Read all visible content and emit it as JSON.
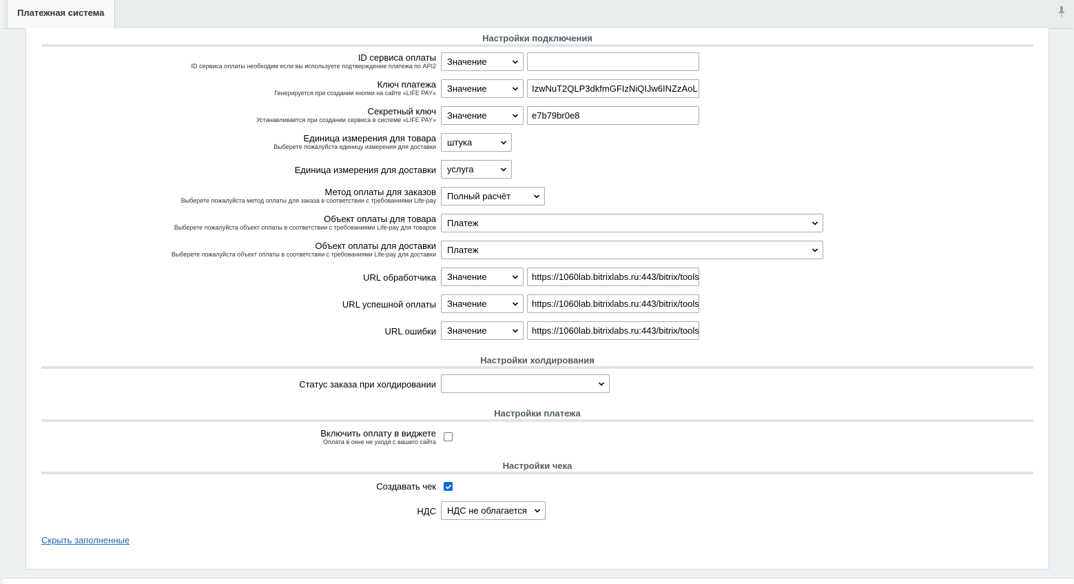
{
  "tab": {
    "title": "Платежная система"
  },
  "sections": {
    "connection": "Настройки подключения",
    "holding": "Настройки холдирования",
    "payment": "Настройки платежа",
    "receipt": "Настройки чека"
  },
  "fields": {
    "service_id": {
      "label": "ID сервиса оплаты",
      "hint": "ID сервиса оплаты необходим если вы используете подтверждение платежа по API2",
      "type": "Значение",
      "value": ""
    },
    "payment_key": {
      "label": "Ключ платежа",
      "hint": "Генерируется при создании кнопки на сайте «LIFE PAY»",
      "type": "Значение",
      "value": "IzwNuT2QLP3dkfmGFIzNiQIJw6INZzAoL"
    },
    "secret_key": {
      "label": "Секретный ключ",
      "hint": "Устанавливается при создании сервиса в системе «LIFE PAY»",
      "type": "Значение",
      "value": "e7b79br0e8"
    },
    "unit_product": {
      "label": "Единица измерения для товара",
      "hint": "Выберете пожалуйста единицу измерения для доставки",
      "value": "штука"
    },
    "unit_delivery": {
      "label": "Единица измерения для доставки",
      "value": "услуга"
    },
    "payment_method": {
      "label": "Метод оплаты для заказов",
      "hint": "Выберете пожалуйста метод оплаты для заказа в соответствии с требованиями Life-pay",
      "value": "Полный расчёт"
    },
    "object_product": {
      "label": "Объект оплаты для товара",
      "hint": "Выберете пожалуйста объект оплаты в соответствии с требованиями Life-pay для товаров",
      "value": "Платеж"
    },
    "object_delivery": {
      "label": "Объект оплаты для доставки",
      "hint": "Выберете пожалуйста объект оплаты в соответствии с требованиями Life-pay для доставки",
      "value": "Платеж"
    },
    "url_handler": {
      "label": "URL обработчика",
      "type": "Значение",
      "value": "https://1060lab.bitrixlabs.ru:443/bitrix/tools"
    },
    "url_success": {
      "label": "URL успешной оплаты",
      "type": "Значение",
      "value": "https://1060lab.bitrixlabs.ru:443/bitrix/tools"
    },
    "url_error": {
      "label": "URL ошибки",
      "type": "Значение",
      "value": "https://1060lab.bitrixlabs.ru:443/bitrix/tools"
    },
    "hold_status": {
      "label": "Статус заказа при холдировании",
      "value": ""
    },
    "widget": {
      "label": "Включить оплату в виджете",
      "hint": "Оплата в окне не уходя с вашего сайта",
      "checked": false
    },
    "create_receipt": {
      "label": "Создавать чек",
      "checked": true
    },
    "vat": {
      "label": "НДС",
      "value": "НДС не облагается"
    }
  },
  "hide_filled_link": "Скрыть заполненные",
  "colors": {
    "link": "#2067b0",
    "checkbox": "#0b6ad8",
    "section_text": "#525c61"
  }
}
